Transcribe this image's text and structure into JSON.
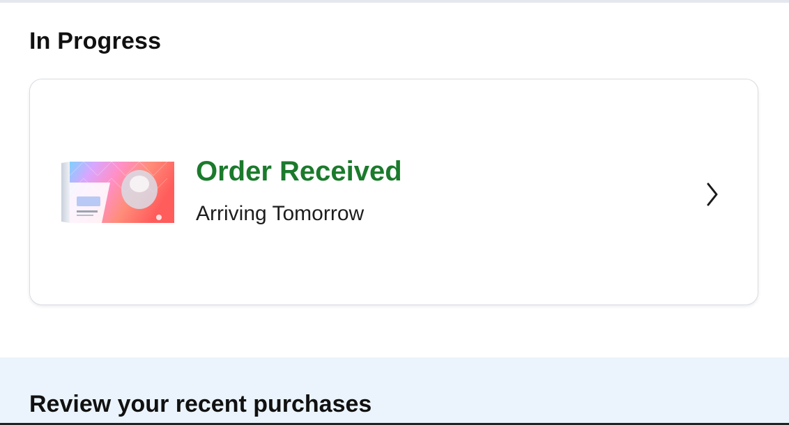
{
  "in_progress": {
    "title": "In Progress",
    "order": {
      "status": "Order Received",
      "delivery": "Arriving Tomorrow",
      "status_color": "#1b7a2c",
      "thumbnail_icon": "product-box-image",
      "action_icon": "chevron-right-icon"
    }
  },
  "review": {
    "title": "Review your recent purchases",
    "background_color": "#ebf4fc"
  }
}
